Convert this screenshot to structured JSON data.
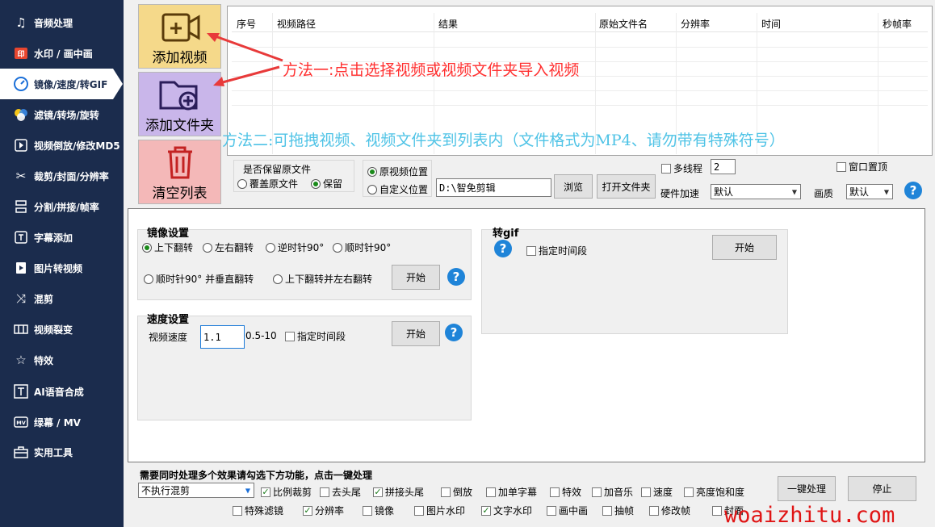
{
  "sidebar": {
    "items": [
      {
        "label": "音频处理",
        "icon": "music-note-icon"
      },
      {
        "label": "水印 / 画中画",
        "icon": "watermark-icon"
      },
      {
        "label": "镜像/速度/转GIF",
        "icon": "speed-gauge-icon"
      },
      {
        "label": "滤镜/转场/旋转",
        "icon": "palette-icon"
      },
      {
        "label": "视频倒放/修改MD5",
        "icon": "reverse-play-icon"
      },
      {
        "label": "裁剪/封面/分辨率",
        "icon": "scissors-icon"
      },
      {
        "label": "分割/拼接/帧率",
        "icon": "split-icon"
      },
      {
        "label": "字幕添加",
        "icon": "text-t-icon"
      },
      {
        "label": "图片转视频",
        "icon": "image-to-video-icon"
      },
      {
        "label": "混剪",
        "icon": "shuffle-icon"
      },
      {
        "label": "视频裂变",
        "icon": "film-grid-icon"
      },
      {
        "label": "特效",
        "icon": "sparkle-icon"
      },
      {
        "label": "AI语音合成",
        "icon": "ai-voice-icon"
      },
      {
        "label": "绿幕 / MV",
        "icon": "mv-icon"
      },
      {
        "label": "实用工具",
        "icon": "toolbox-icon"
      }
    ]
  },
  "buttons": {
    "add_video": "添加视频",
    "add_folder": "添加文件夹",
    "clear_list": "清空列表"
  },
  "table": {
    "columns": [
      "序号",
      "视频路径",
      "结果",
      "原始文件名",
      "分辨率",
      "时间",
      "秒帧率"
    ]
  },
  "annotations": {
    "method1": "方法一:点击选择视频或视频文件夹导入视频",
    "method2": "方法二:可拖拽视频、视频文件夹到列表内（文件格式为MP4、请勿带有特殊符号）"
  },
  "options": {
    "keep_original_label": "是否保留原文件",
    "overwrite": "覆盖原文件",
    "keep": "保留",
    "original_location": "原视频位置",
    "custom_location": "自定义位置",
    "output_path": "D:\\智免剪辑",
    "browse": "浏览",
    "open_folder": "打开文件夹",
    "multithread": "多线程",
    "thread_count": "2",
    "window_top": "窗口置顶",
    "hw_accel_label": "硬件加速",
    "hw_accel_value": "默认",
    "quality_label": "画质",
    "quality_value": "默认"
  },
  "mirror": {
    "title": "镜像设置",
    "flip_v": "上下翻转",
    "flip_h": "左右翻转",
    "ccw90": "逆时针90°",
    "cw90": "顺时针90°",
    "cw90_vflip": "顺时针90° 并垂直翻转",
    "vflip_hflip": "上下翻转并左右翻转",
    "start": "开始"
  },
  "speed": {
    "title": "速度设置",
    "label": "视频速度",
    "value": "1.1",
    "range": "0.5-10",
    "time_segment": "指定时间段",
    "start": "开始"
  },
  "gif": {
    "title": "转gif",
    "time_segment": "指定时间段",
    "start": "开始"
  },
  "bottom": {
    "hint": "需要同时处理多个效果请勾选下方功能，点击一键处理",
    "mix_value": "不执行混剪",
    "row1": [
      {
        "label": "比例裁剪",
        "checked": true
      },
      {
        "label": "去头尾",
        "checked": false
      },
      {
        "label": "拼接头尾",
        "checked": true
      },
      {
        "label": "倒放",
        "checked": false
      },
      {
        "label": "加单字幕",
        "checked": false
      },
      {
        "label": "特效",
        "checked": false
      },
      {
        "label": "加音乐",
        "checked": false
      },
      {
        "label": "速度",
        "checked": false
      },
      {
        "label": "亮度饱和度",
        "checked": false
      }
    ],
    "row2": [
      {
        "label": "特殊滤镜",
        "checked": false
      },
      {
        "label": "分辨率",
        "checked": true
      },
      {
        "label": "镜像",
        "checked": false
      },
      {
        "label": "图片水印",
        "checked": false
      },
      {
        "label": "文字水印",
        "checked": true
      },
      {
        "label": "画中画",
        "checked": false
      },
      {
        "label": "抽帧",
        "checked": false
      },
      {
        "label": "修改帧",
        "checked": false
      },
      {
        "label": "封面",
        "checked": false
      }
    ],
    "one_click": "一键处理",
    "stop": "停止"
  },
  "watermark": "woaizhitu.com"
}
